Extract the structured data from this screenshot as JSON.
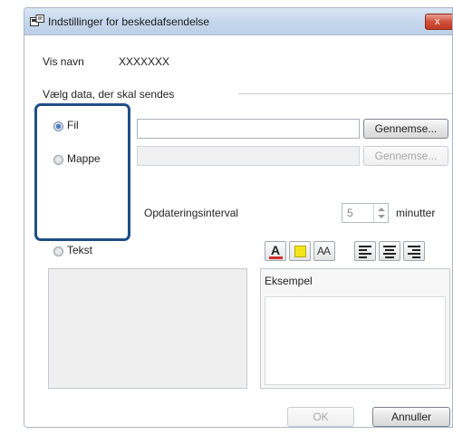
{
  "window": {
    "title": "Indstillinger for beskedafsendelse",
    "close_glyph": "x"
  },
  "display_name": {
    "label": "Vis navn",
    "value": "XXXXXXX"
  },
  "group": {
    "label": "Vælg data, der skal sendes"
  },
  "options": {
    "file": {
      "label": "Fil",
      "checked": true
    },
    "folder": {
      "label": "Mappe",
      "checked": false
    },
    "text": {
      "label": "Tekst",
      "checked": false
    }
  },
  "file_row": {
    "value": "",
    "browse_label": "Gennemse..."
  },
  "folder_row": {
    "value": "",
    "browse_label": "Gennemse..."
  },
  "update_interval": {
    "label": "Opdateringsinterval",
    "value": "5",
    "unit": "minutter"
  },
  "format_toolbar": {
    "font_color_glyph": "A",
    "font_size_glyph": "AA",
    "accent_red": "#d03030",
    "highlight_yellow": "#f2e51c"
  },
  "preview": {
    "label": "Eksempel"
  },
  "footer": {
    "ok_label": "OK",
    "cancel_label": "Annuller"
  }
}
